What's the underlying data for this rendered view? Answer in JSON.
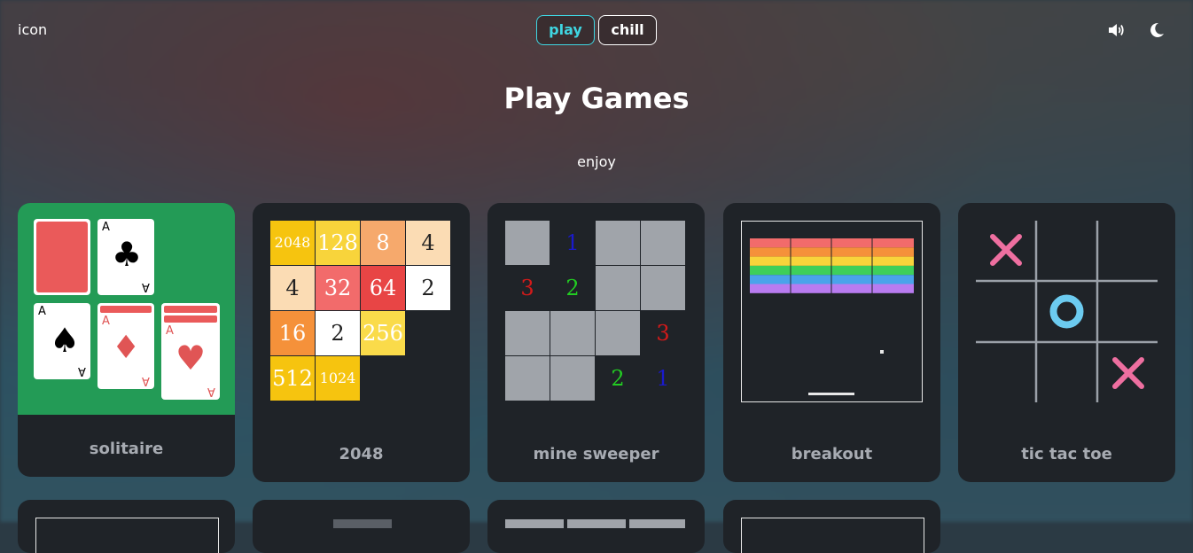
{
  "header": {
    "brand": "icon",
    "modes": [
      {
        "label": "play",
        "active": true
      },
      {
        "label": "chill",
        "active": false
      }
    ],
    "icons": [
      "volume-icon",
      "moon-icon"
    ]
  },
  "page": {
    "title": "Play Games",
    "subtitle": "enjoy"
  },
  "games": [
    {
      "label": "solitaire"
    },
    {
      "label": "2048"
    },
    {
      "label": "mine sweeper"
    },
    {
      "label": "breakout"
    },
    {
      "label": "tic tac toe"
    }
  ],
  "solitaire_cards": [
    "A",
    "A",
    "A",
    "A"
  ],
  "tiles_2048": [
    [
      "2048",
      "128",
      "8",
      "4"
    ],
    [
      "4",
      "32",
      "64",
      "2"
    ],
    [
      "16",
      "2",
      "256",
      ""
    ],
    [
      "512",
      "1024",
      "",
      ""
    ]
  ],
  "minesweeper": [
    [
      "",
      "1",
      "",
      ""
    ],
    [
      "3",
      "2",
      "",
      ""
    ],
    [
      "",
      "",
      "",
      "3"
    ],
    [
      "",
      "",
      "2",
      "1"
    ]
  ],
  "tictactoe": {
    "marks": [
      "X",
      "O",
      "X"
    ]
  },
  "colors": {
    "accent": "#3fd6e2",
    "card_bg": "#1f2328",
    "solitaire_green": "#239b56",
    "x_pink": "#ee6fa0",
    "o_blue": "#6ccbf0"
  }
}
